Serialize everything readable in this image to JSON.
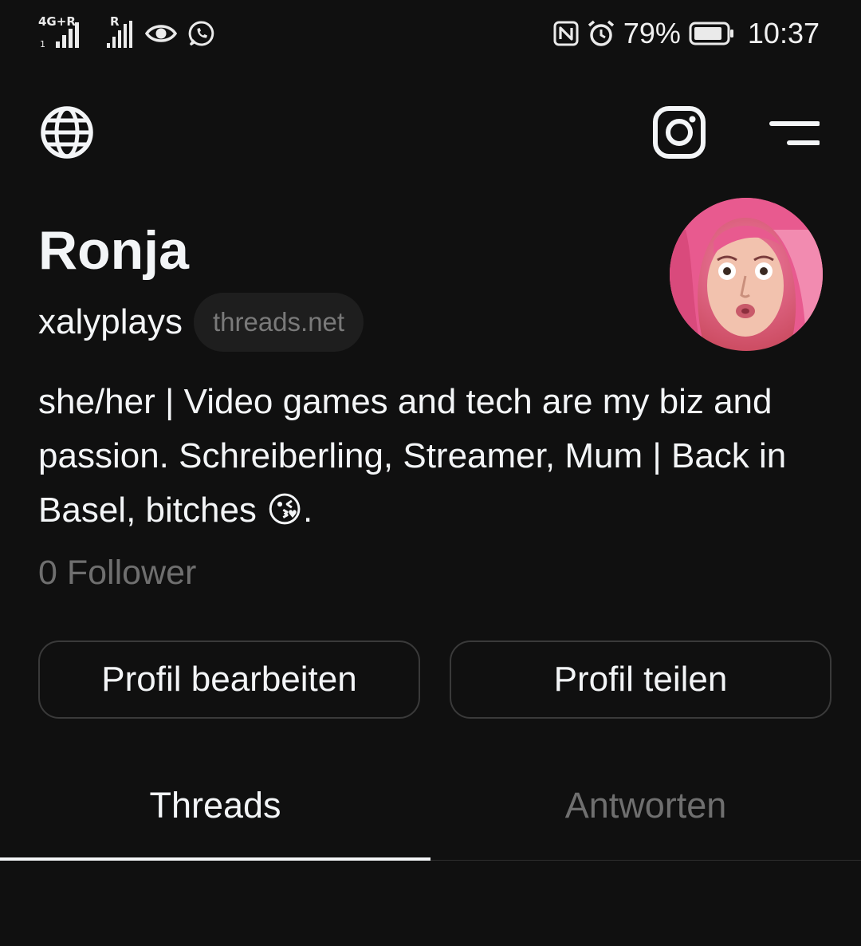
{
  "status_bar": {
    "network_type": "4G+R",
    "sim2_tag": "R",
    "battery_percent": "79%",
    "time": "10:37",
    "icons": [
      "signal-bars-icon",
      "signal-bars-icon",
      "eye-icon",
      "whatsapp-icon",
      "nfc-icon",
      "alarm-icon",
      "battery-icon"
    ]
  },
  "header": {
    "left_icon": "globe-icon",
    "right_icons": [
      "instagram-icon",
      "menu-icon"
    ]
  },
  "profile": {
    "name": "Ronja",
    "username": "xalyplays",
    "domain_badge": "threads.net",
    "bio": "she/her | Video games and tech are my biz and passion. Schreiberling, Streamer, Mum | Back in Basel, bitches 😘.",
    "followers": "0 Follower",
    "avatar_colors": [
      "#e85a8f",
      "#f07da5",
      "#c9485c",
      "#f2c2ae"
    ]
  },
  "actions": {
    "edit_label": "Profil bearbeiten",
    "share_label": "Profil teilen"
  },
  "tabs": [
    {
      "label": "Threads",
      "active": true
    },
    {
      "label": "Antworten",
      "active": false
    }
  ],
  "colors": {
    "background": "#101010",
    "text_primary": "#f3f5f7",
    "text_secondary": "#6f6f6f",
    "border": "#3a3a3a"
  }
}
